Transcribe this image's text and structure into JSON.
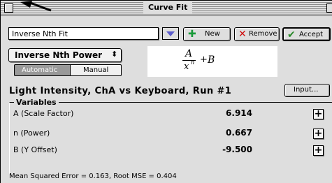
{
  "window": {
    "title": "Curve Fit"
  },
  "fit_select": {
    "value": "Inverse Nth Fit"
  },
  "toolbar": {
    "new_label": "New",
    "remove_label": "Remove",
    "accept_label": "Accept",
    "new_icon": "plus-icon",
    "remove_icon": "x-icon",
    "accept_icon": "checkmark-icon"
  },
  "function_popup": {
    "value": "Inverse Nth Power",
    "arrows": "⬍"
  },
  "mode": {
    "automatic_label": "Automatic",
    "manual_label": "Manual",
    "selected": "Automatic"
  },
  "formula": {
    "numerator": "A",
    "denominator": "x",
    "exponent": "n",
    "plus": "+",
    "offset": "B"
  },
  "run_title": "Light Intensity, ChA vs Keyboard, Run #1",
  "input_button": {
    "label": "Input..."
  },
  "variables": {
    "group_label": "Variables",
    "items": [
      {
        "name": "A (Scale Factor)",
        "value": "6.914",
        "button": "+"
      },
      {
        "name": "n (Power)",
        "value": "0.667",
        "button": "+"
      },
      {
        "name": "B (Y Offset)",
        "value": "-9.500",
        "button": "+"
      }
    ]
  },
  "status": "Mean Squared Error = 0.163, Root MSE = 0.404",
  "colors": {
    "window_bg": "#dedede",
    "accept_check": "#2a8a2a",
    "new_plus": "#1a9a3a",
    "remove_x": "#d01010",
    "dropdown_arrow": "#5c5ccc"
  }
}
